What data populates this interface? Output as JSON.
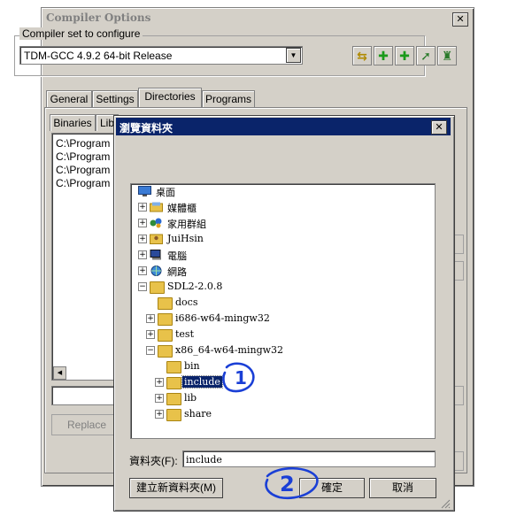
{
  "compiler_options": {
    "title": "Compiler Options",
    "close_label": "✕",
    "group_label": "Compiler set to configure",
    "compiler_set": "TDM-GCC 4.9.2 64-bit Release",
    "tabs": [
      {
        "label": "General"
      },
      {
        "label": "Settings"
      },
      {
        "label": "Directories"
      },
      {
        "label": "Programs"
      }
    ],
    "subtabs": [
      {
        "label": "Binaries"
      },
      {
        "label": "Lib"
      }
    ],
    "directories": [
      "C:\\Program I",
      "C:\\Program I",
      "C:\\Program I",
      "C:\\Program I"
    ],
    "replace_label": "Replace"
  },
  "browse_dialog": {
    "title": "瀏覽資料夾",
    "close_label": "✕",
    "tree": [
      {
        "label": "桌面",
        "icon": "desktop-icon",
        "expander": ""
      },
      {
        "label": "媒體櫃",
        "icon": "library-icon",
        "expander": "+"
      },
      {
        "label": "家用群組",
        "icon": "homegroup-icon",
        "expander": "+"
      },
      {
        "label": "JuiHsin",
        "icon": "user-folder-icon",
        "expander": "+"
      },
      {
        "label": "電腦",
        "icon": "computer-icon",
        "expander": "+"
      },
      {
        "label": "網路",
        "icon": "network-icon",
        "expander": "+"
      },
      {
        "label": "SDL2-2.0.8",
        "icon": "folder-icon",
        "expander": "−"
      },
      {
        "label": "docs",
        "icon": "folder-icon",
        "expander": ""
      },
      {
        "label": "i686-w64-mingw32",
        "icon": "folder-icon",
        "expander": "+"
      },
      {
        "label": "test",
        "icon": "folder-icon",
        "expander": "+"
      },
      {
        "label": "x86_64-w64-mingw32",
        "icon": "folder-icon",
        "expander": "−"
      },
      {
        "label": "bin",
        "icon": "folder-icon",
        "expander": ""
      },
      {
        "label": "include",
        "icon": "folder-icon",
        "expander": "+",
        "selected": true
      },
      {
        "label": "lib",
        "icon": "folder-icon",
        "expander": "+"
      },
      {
        "label": "share",
        "icon": "folder-icon",
        "expander": "+"
      }
    ],
    "folder_label": "資料夾(F):",
    "folder_value": "include",
    "new_folder_label": "建立新資料夾(M)",
    "ok_label": "確定",
    "cancel_label": "取消"
  },
  "annotations": {
    "mark_1": "1",
    "mark_2": "2",
    "color": "#1a3fd6"
  },
  "colors": {
    "titlebar_active": "#0a246a",
    "dialog_face": "#d4d0c8",
    "selection": "#0a246a"
  }
}
